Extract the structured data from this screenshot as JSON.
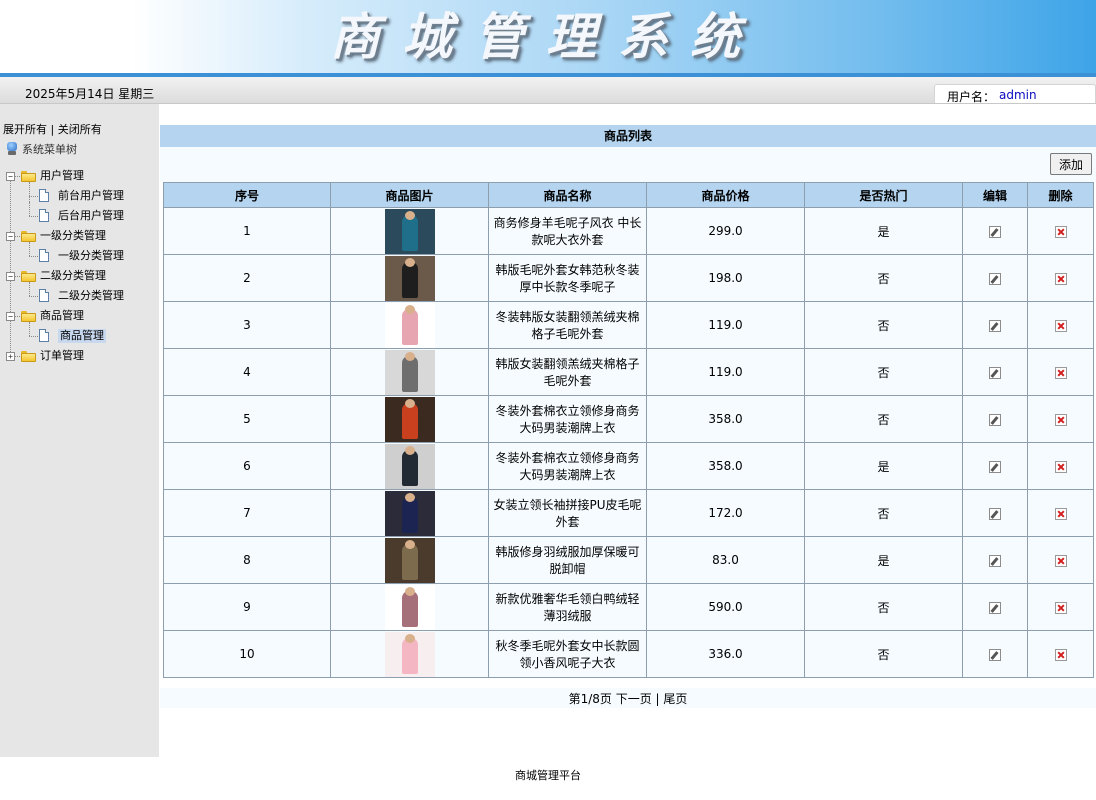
{
  "banner": {
    "title": "商城管理系统"
  },
  "statusbar": {
    "date": "2025年5月14日 星期三",
    "user_label": "用户名：",
    "user_value": "admin"
  },
  "sidebar": {
    "expand_all": "展开所有",
    "separator": " | ",
    "collapse_all": "关闭所有",
    "root_label": "系统菜单树",
    "nodes": [
      {
        "label": "用户管理",
        "type": "folder",
        "children": [
          "前台用户管理",
          "后台用户管理"
        ]
      },
      {
        "label": "一级分类管理",
        "type": "folder",
        "children": [
          "一级分类管理"
        ]
      },
      {
        "label": "二级分类管理",
        "type": "folder",
        "children": [
          "二级分类管理"
        ]
      },
      {
        "label": "商品管理",
        "type": "folder",
        "children": [
          "商品管理"
        ]
      },
      {
        "label": "订单管理",
        "type": "folder",
        "collapsed": true,
        "children": []
      }
    ],
    "selected": "商品管理"
  },
  "main": {
    "list_title": "商品列表",
    "add_label": "添加",
    "columns": [
      "序号",
      "商品图片",
      "商品名称",
      "商品价格",
      "是否热门",
      "编辑",
      "删除"
    ],
    "rows": [
      {
        "no": "1",
        "name": "商务修身羊毛呢子风衣 中长款呢大衣外套",
        "price": "299.0",
        "hot": "是",
        "image": "teal-jacket",
        "colors": [
          "#2b4a5c",
          "#1f6f8b"
        ]
      },
      {
        "no": "2",
        "name": "韩版毛呢外套女韩范秋冬装厚中长款冬季呢子",
        "price": "198.0",
        "hot": "否",
        "image": "black-coat",
        "colors": [
          "#6b5a4a",
          "#1e1e1e"
        ]
      },
      {
        "no": "3",
        "name": "冬装韩版女装翻领羔绒夹棉格子毛呢外套",
        "price": "119.0",
        "hot": "否",
        "image": "pink-coat",
        "colors": [
          "#ffffff",
          "#e6a5b0"
        ]
      },
      {
        "no": "4",
        "name": "韩版女装翻领羔绒夹棉格子毛呢外套",
        "price": "119.0",
        "hot": "否",
        "image": "grey-plaid-coat",
        "colors": [
          "#d8d8d8",
          "#6e6e6e"
        ]
      },
      {
        "no": "5",
        "name": "冬装外套棉衣立领修身商务大码男装潮牌上衣",
        "price": "358.0",
        "hot": "否",
        "image": "red-jacket",
        "colors": [
          "#3a2a20",
          "#c8401e"
        ]
      },
      {
        "no": "6",
        "name": "冬装外套棉衣立领修身商务大码男装潮牌上衣",
        "price": "358.0",
        "hot": "是",
        "image": "dark-suit",
        "colors": [
          "#cfcfcf",
          "#222a33"
        ]
      },
      {
        "no": "7",
        "name": "女装立领长袖拼接PU皮毛呢外套",
        "price": "172.0",
        "hot": "否",
        "image": "navy-coat",
        "colors": [
          "#2b2b3a",
          "#1c2452"
        ]
      },
      {
        "no": "8",
        "name": "韩版修身羽绒服加厚保暖可脱卸帽",
        "price": "83.0",
        "hot": "是",
        "image": "plaid-jacket",
        "colors": [
          "#4a3b2c",
          "#7d6b4e"
        ]
      },
      {
        "no": "9",
        "name": "新款优雅奢华毛领白鸭绒轻薄羽绒服",
        "price": "590.0",
        "hot": "否",
        "image": "patterned-sweater",
        "colors": [
          "#ffffff",
          "#a6707a"
        ]
      },
      {
        "no": "10",
        "name": "秋冬季毛呢外套女中长款圆领小香风呢子大衣",
        "price": "336.0",
        "hot": "否",
        "image": "light-pink-coat",
        "colors": [
          "#f7eef0",
          "#f3b6c2"
        ]
      }
    ],
    "pager": {
      "page_info": "第1/8页",
      "next": "下一页",
      "separator": " | ",
      "last": "尾页"
    }
  },
  "footer": {
    "text": "商城管理平台"
  },
  "icons": {
    "edit": "edit-icon",
    "delete": "delete-icon",
    "folder": "folder-icon",
    "document": "document-icon",
    "root": "computer-icon"
  }
}
